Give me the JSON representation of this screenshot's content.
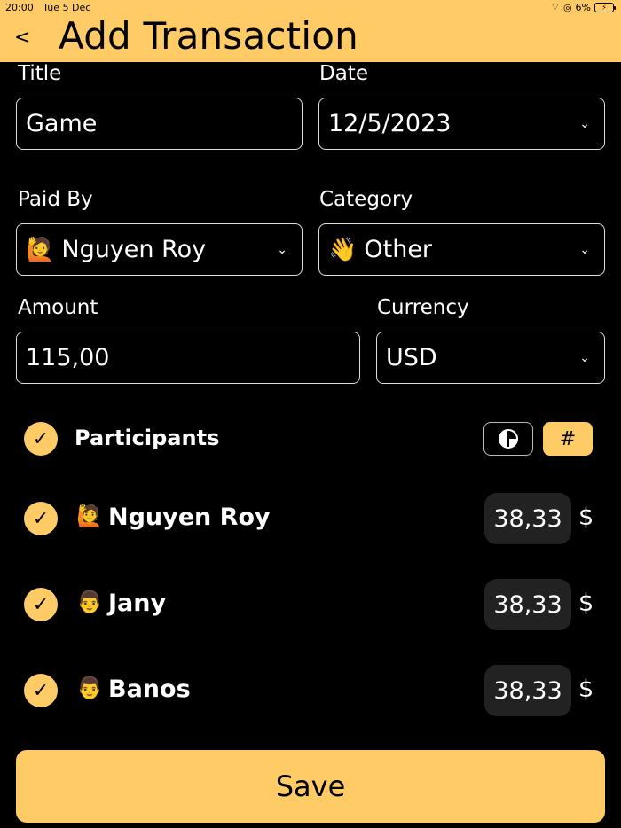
{
  "status": {
    "time": "20:00",
    "date": "Tue 5 Dec",
    "battery": "6%"
  },
  "header": {
    "title": "Add Transaction",
    "back": "<"
  },
  "form": {
    "title_label": "Title",
    "title_value": "Game",
    "date_label": "Date",
    "date_value": "12/5/2023",
    "paid_by_label": "Paid By",
    "paid_by_emoji": "🙋",
    "paid_by_value": "Nguyen Roy",
    "category_label": "Category",
    "category_emoji": "👋",
    "category_value": "Other",
    "amount_label": "Amount",
    "amount_value": "115,00",
    "currency_label": "Currency",
    "currency_value": "USD"
  },
  "participants": {
    "title": "Participants",
    "mode_hash": "#",
    "items": [
      {
        "emoji": "🙋",
        "name": "Nguyen Roy",
        "amount": "38,33",
        "currency": "$"
      },
      {
        "emoji": "👨",
        "name": "Jany",
        "amount": "38,33",
        "currency": "$"
      },
      {
        "emoji": "👨",
        "name": "Banos",
        "amount": "38,33",
        "currency": "$"
      }
    ]
  },
  "save_label": "Save",
  "colors": {
    "accent": "#FFCB66",
    "background": "#000000",
    "amount_bg": "#222222"
  }
}
